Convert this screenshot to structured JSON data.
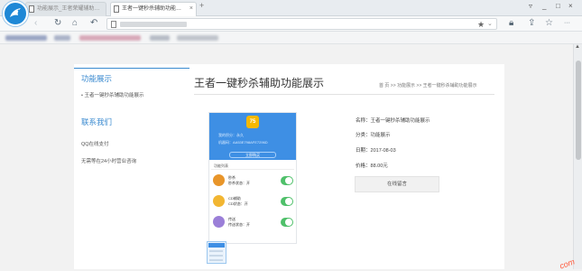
{
  "browser": {
    "tabs": [
      {
        "label": "功能展示_王者荣耀辅助…",
        "active": false
      },
      {
        "label": "王者一键秒杀辅助功能…",
        "active": true
      }
    ],
    "new_tab": "+",
    "window_controls": {
      "minimize": "_",
      "maximize": "□",
      "close": "×",
      "settings": "▿"
    },
    "toolbar_right": {
      "star": "☆",
      "more": "···"
    }
  },
  "sidebar": {
    "section1_title": "功能展示",
    "section1_item": "• 王者一键秒杀辅助功能展示",
    "section2_title": "联系我们",
    "contact_qq": "QQ在线支付",
    "contact_service": "无需等在24小时营业咨询"
  },
  "main": {
    "title": "王者一键秒杀辅助功能展示",
    "breadcrumb": "首 页  >>  功能展示  >>  王者一键秒杀辅助功能展示"
  },
  "phone": {
    "badge": "75",
    "info_line1": "我的积分：永久",
    "info_line2": "机器码：AA53E798AFE7296D",
    "button": "立即购买",
    "section": "功能列表",
    "features": [
      {
        "name": "秒杀",
        "desc": "秒杀状态：开",
        "color": "#e8952a"
      },
      {
        "name": "CD辅助",
        "desc": "CD状态：开",
        "color": "#f2b632"
      },
      {
        "name": "传送",
        "desc": "传送状态：开",
        "color": "#9b7fd8"
      }
    ]
  },
  "product": {
    "name_label": "名称：",
    "name_value": "王者一键秒杀辅助功能展示",
    "category_label": "分类：",
    "category_value": "功能展示",
    "date_label": "日期：",
    "date_value": "2017-08-03",
    "price_label": "价格：",
    "price_value": "88.00元",
    "buy_button": "在线留言"
  },
  "watermark": "com"
}
